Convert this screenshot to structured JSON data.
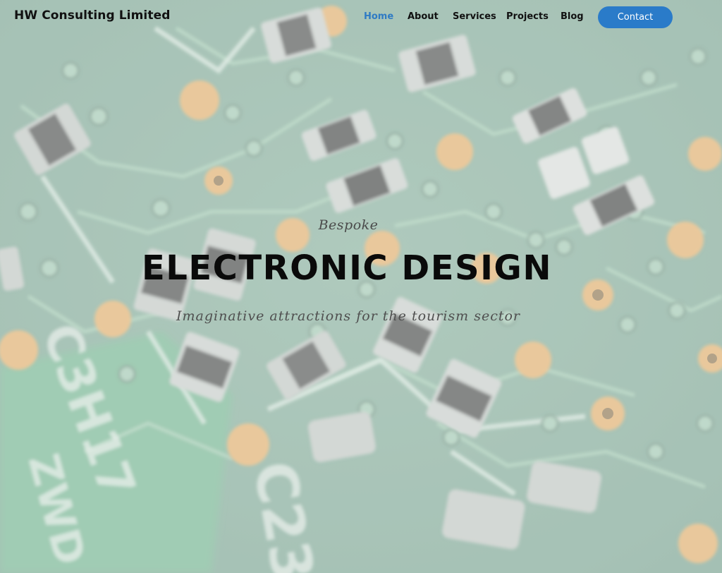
{
  "header": {
    "brand": "HW Consulting Limited",
    "nav": {
      "home": "Home",
      "about": "About",
      "services": "Services",
      "projects": "Projects",
      "blog": "Blog"
    },
    "active_item": "Home",
    "contact_label": "Contact"
  },
  "hero": {
    "kicker": "Bespoke",
    "title": "ELECTRONIC DESIGN",
    "subtitle": "Imaginative attractions for the tourism sector"
  },
  "colors": {
    "accent": "#2a7bc9",
    "active_nav": "#2f7bc4",
    "background": "#9fb8ad"
  }
}
